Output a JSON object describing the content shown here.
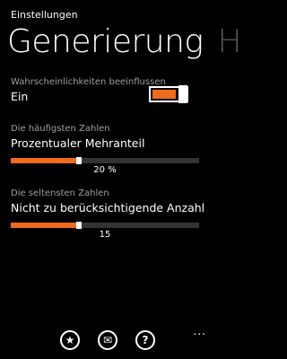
{
  "header": {
    "app_title": "Einstellungen"
  },
  "pivot": {
    "active_title": "Generierung",
    "next_title": "H"
  },
  "settings": {
    "influence": {
      "label": "Wahrscheinlichkeiten beeinflussen",
      "value": "Ein",
      "enabled": true
    },
    "frequent": {
      "label": "Die häufigsten Zahlen",
      "value": "Prozentualer Mehranteil",
      "slider_value_label": "20 %",
      "slider_fraction": 0.36
    },
    "rare": {
      "label": "Die seltensten Zahlen",
      "value": "Nicht zu berücksichtigende Anzahl",
      "slider_value_label": "15",
      "slider_fraction": 0.36
    }
  },
  "appbar": {
    "buttons": [
      {
        "icon": "favorite-star-icon",
        "glyph": "★"
      },
      {
        "icon": "mail-icon",
        "glyph": "✉"
      },
      {
        "icon": "help-icon",
        "glyph": "?"
      }
    ],
    "more": "..."
  },
  "colors": {
    "accent": "#f06b1b",
    "track": "#333333",
    "subtle": "#a0a0a0"
  }
}
